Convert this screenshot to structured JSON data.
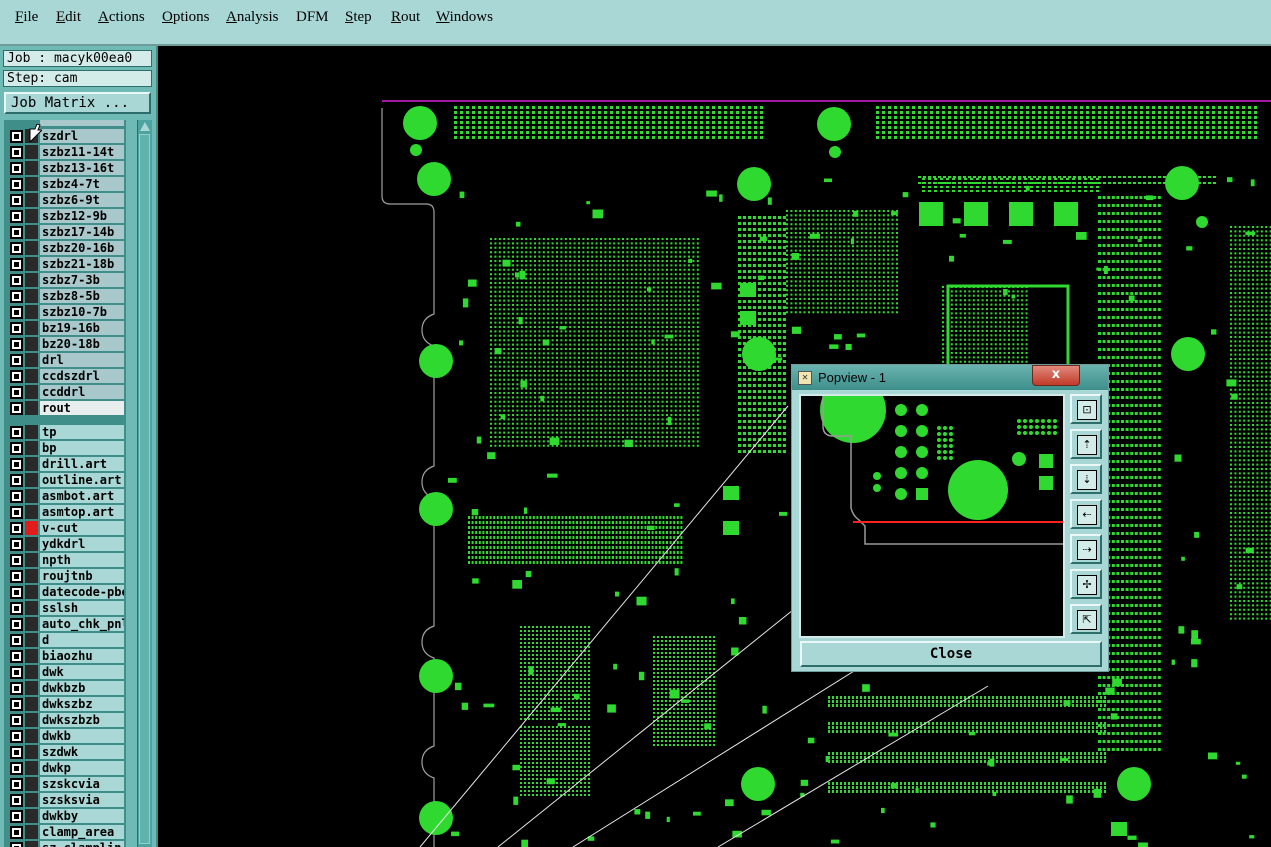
{
  "menubar": {
    "items": [
      {
        "label": "File",
        "u": "F",
        "rest": "ile"
      },
      {
        "label": "Edit",
        "u": "E",
        "rest": "dit"
      },
      {
        "label": "Actions",
        "u": "A",
        "rest": "ctions"
      },
      {
        "label": "Options",
        "u": "O",
        "rest": "ptions"
      },
      {
        "label": "Analysis",
        "u": "A",
        "rest": "nalysis"
      },
      {
        "label": "DFM",
        "u": "",
        "rest": "DFM"
      },
      {
        "label": "Step",
        "u": "S",
        "rest": "tep"
      },
      {
        "label": "Rout",
        "u": "R",
        "rest": "out"
      },
      {
        "label": "Windows",
        "u": "W",
        "rest": "indows"
      }
    ]
  },
  "job": {
    "job_label": "Job : macyk00ea0",
    "step_label": "Step: cam",
    "matrix_button": "Job Matrix ..."
  },
  "layers": {
    "group1": [
      "szdrl",
      "szbz11-14t",
      "szbz13-16t",
      "szbz4-7t",
      "szbz6-9t",
      "szbz12-9b",
      "szbz17-14b",
      "szbz20-16b",
      "szbz21-18b",
      "szbz7-3b",
      "szbz8-5b",
      "szbz10-7b",
      "bz19-16b",
      "bz20-18b",
      "drl",
      "ccdszdrl",
      "ccddrl",
      "rout"
    ],
    "group2": [
      "tp",
      "bp",
      "drill.art",
      "outline.art",
      "asmbot.art",
      "asmtop.art",
      "v-cut",
      "ydkdrl",
      "npth",
      "roujtnb",
      "datecode-pbe",
      "sslsh",
      "auto_chk_pnl",
      "d",
      "biaozhu",
      "dwk",
      "dwkbzb",
      "dwkszbz",
      "dwkszbzb",
      "dwkb",
      "szdwk",
      "dwkp",
      "szskcvia",
      "szsksvia",
      "dwkby",
      "clamp_area",
      "sz_clamplin"
    ],
    "selected": "rout",
    "red_layer": "v-cut",
    "colors": {
      "trace": "#2fd92f",
      "outline": "#d61fd6",
      "selection": "#ff2020",
      "panel": "#6fbab5",
      "menubar": "#a9d7d5"
    }
  },
  "popview": {
    "title": "Popview - 1",
    "close_x": "x",
    "close_button": "Close",
    "tool_icons": [
      "zoom-fit-icon",
      "pan-up-icon",
      "pan-down-icon",
      "pan-left-icon",
      "pan-right-icon",
      "zoom-in-icon",
      "zoom-out-icon"
    ]
  }
}
